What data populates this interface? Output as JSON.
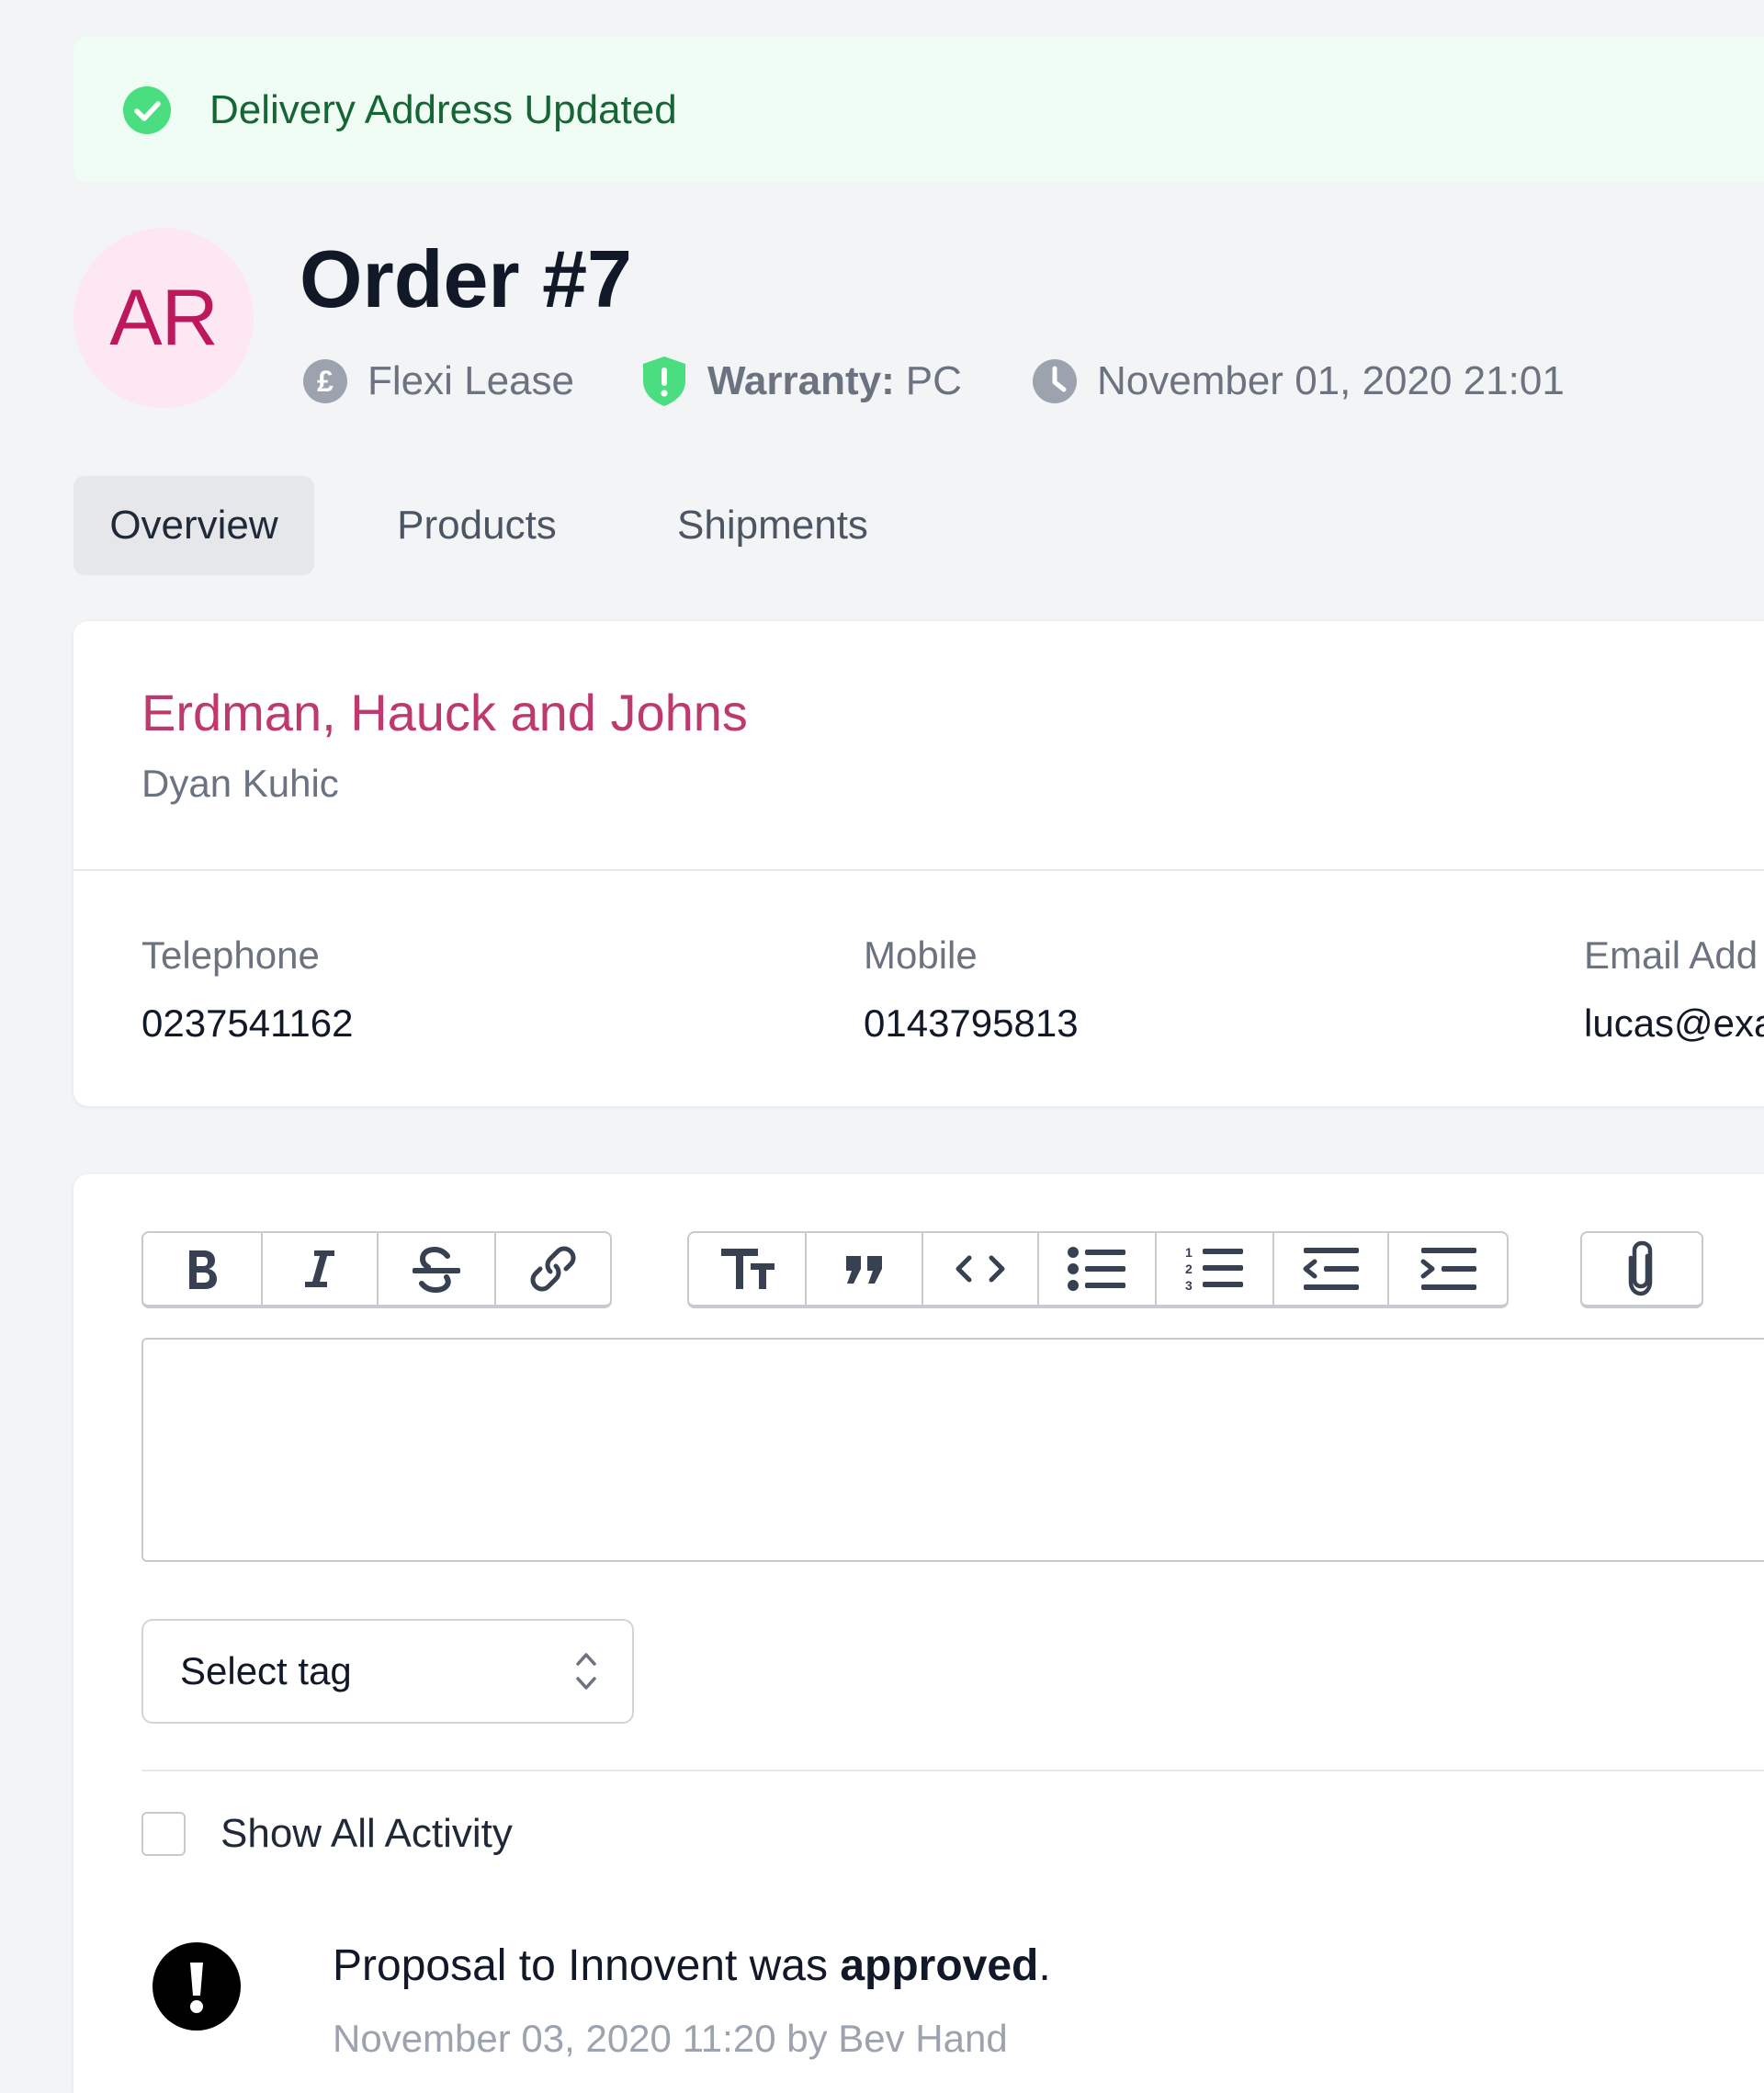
{
  "alert": {
    "message": "Delivery Address Updated",
    "icon": "check-circle-icon",
    "color": "#166534"
  },
  "header": {
    "avatar_initials": "AR",
    "order_title": "Order #7",
    "meta": {
      "plan": "Flexi Lease",
      "plan_icon": "pound-circle-icon",
      "warranty_label": "Warranty:",
      "warranty_value": "PC",
      "warranty_icon": "shield-exclamation-icon",
      "date": "November 01, 2020 21:01",
      "date_icon": "clock-icon"
    }
  },
  "tabs": [
    {
      "label": "Overview",
      "active": true
    },
    {
      "label": "Products",
      "active": false
    },
    {
      "label": "Shipments",
      "active": false
    }
  ],
  "customer": {
    "company": "Erdman, Hauck and Johns",
    "contact_name": "Dyan Kuhic",
    "fields": [
      {
        "label": "Telephone",
        "value": "0237541162"
      },
      {
        "label": "Mobile",
        "value": "0143795813"
      },
      {
        "label": "Email Add",
        "value": "lucas@exa"
      }
    ]
  },
  "editor": {
    "toolbar": [
      "bold-icon",
      "italic-icon",
      "strikethrough-icon",
      "link-icon",
      "heading-icon",
      "quote-icon",
      "code-icon",
      "bullet-list-icon",
      "numbered-list-icon",
      "decrease-indent-icon",
      "increase-indent-icon",
      "attach-icon"
    ],
    "content": ""
  },
  "tag_select": {
    "label": "Select tag"
  },
  "activity": {
    "show_all_label": "Show All Activity",
    "show_all_checked": false,
    "items": [
      {
        "text_prefix": "Proposal to Innovent was ",
        "text_bold": "approved",
        "text_suffix": ".",
        "meta": "November 03, 2020 11:20 by Bev Hand",
        "icon": "exclamation-icon"
      }
    ]
  },
  "colors": {
    "accent_pink": "#be3a6e",
    "success_green": "#166534",
    "warranty_green": "#4ade80",
    "background": "#f3f4f6"
  }
}
